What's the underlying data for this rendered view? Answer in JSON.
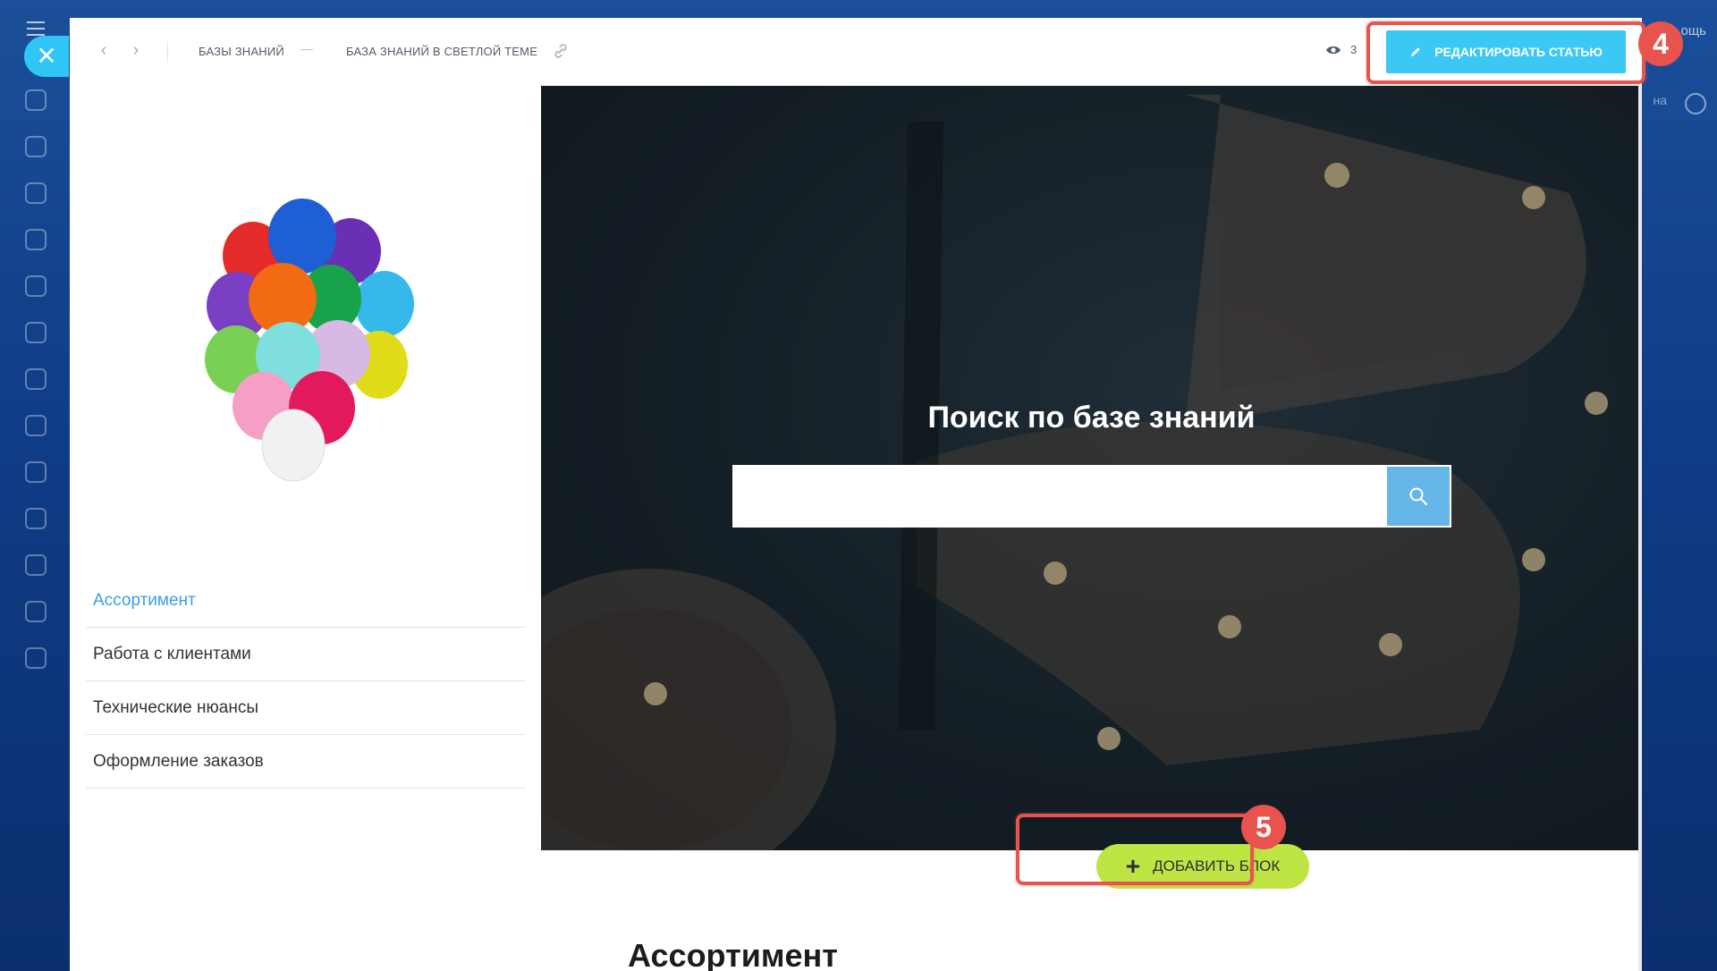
{
  "background": {
    "right_label": "ощь",
    "right_pill": "на"
  },
  "topbar": {
    "breadcrumb": [
      "Базы знаний",
      "База знаний в светлой теме"
    ],
    "views_count": "3",
    "edit_label": "Редактировать статью",
    "badge_edit": "4"
  },
  "sidebar": {
    "menu": [
      {
        "label": "Ассортимент",
        "active": true
      },
      {
        "label": "Работа с клиентами",
        "active": false
      },
      {
        "label": "Технические нюансы",
        "active": false
      },
      {
        "label": "Оформление заказов",
        "active": false
      }
    ]
  },
  "hero": {
    "title": "Поиск по базе знаний",
    "search_placeholder": ""
  },
  "add_block": {
    "label": "Добавить блок",
    "badge": "5"
  },
  "content": {
    "section_title": "Ассортимент"
  },
  "colors": {
    "accent_blue": "#3bc8f5",
    "search_button": "#66b6ea",
    "add_button": "#bfe545",
    "highlight": "#e8534e",
    "active_menu": "#3c9ee6"
  },
  "icons": [
    "close-icon",
    "chevron-left-icon",
    "chevron-right-icon",
    "link-icon",
    "eye-icon",
    "pencil-icon",
    "search-icon",
    "plus-icon",
    "balloons-image"
  ]
}
